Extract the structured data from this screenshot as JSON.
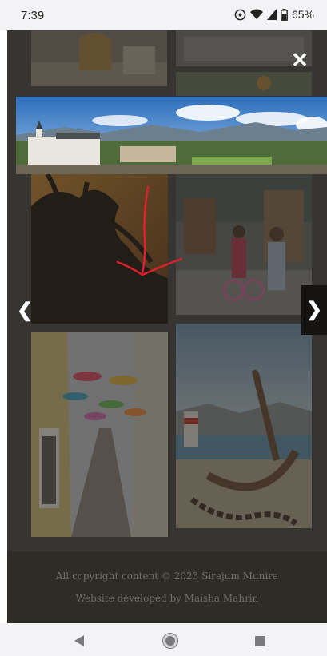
{
  "status_bar": {
    "time": "7:39",
    "battery": "65%",
    "icons": [
      "hotspot-icon",
      "wifi-icon",
      "cellular-icon",
      "battery-icon"
    ]
  },
  "lightbox": {
    "close_label": "✕",
    "prev_label": "❮",
    "next_label": "❯"
  },
  "footer": {
    "copyright": "All copyright content © 2023 Sirajum Munira",
    "developer": "Website developed by Maisha Mahrin"
  },
  "nav_bar": {
    "icons": [
      "back-icon",
      "home-icon",
      "recents-icon"
    ]
  },
  "colors": {
    "overlay": "#4b4844",
    "footer": "#2d2c27",
    "sky_blue": "#3a7fc4",
    "annotation_red": "#e0202e"
  }
}
